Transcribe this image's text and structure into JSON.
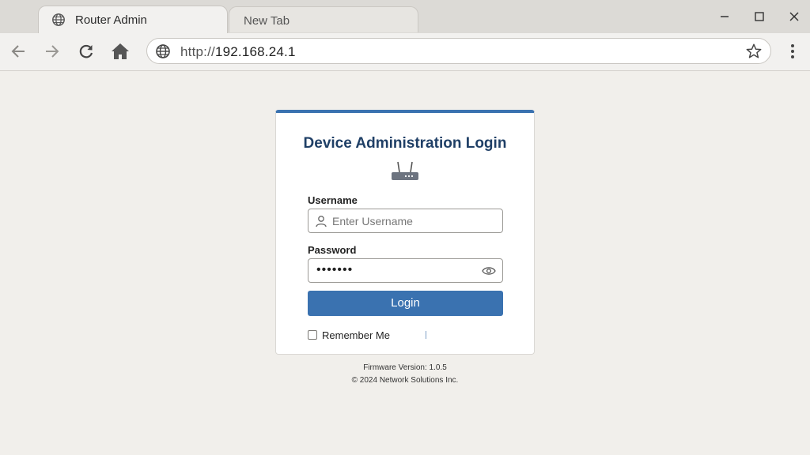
{
  "browser": {
    "tabs": [
      {
        "title": "Router Admin",
        "icon": "globe-icon",
        "active": true
      },
      {
        "title": "New Tab",
        "active": false
      }
    ],
    "window_controls": [
      "minimize-icon",
      "maximize-icon",
      "close-icon"
    ],
    "address_bar": {
      "scheme": "http://",
      "host": "192.168.24.1"
    }
  },
  "login": {
    "title": "Device Administration Login",
    "username_label": "Username",
    "username_placeholder": "Enter Username",
    "password_label": "Password",
    "password_value": "•••••••",
    "login_button": "Login",
    "remember_me": "Remember Me",
    "remember_checked": false
  },
  "footer": {
    "firmware": "Firmware Version: 1.0.5",
    "copyright": "© 2024 Network Solutions Inc."
  },
  "colors": {
    "accent": "#3a72b0",
    "title": "#1f3f66",
    "page_bg": "#f1efeb"
  }
}
